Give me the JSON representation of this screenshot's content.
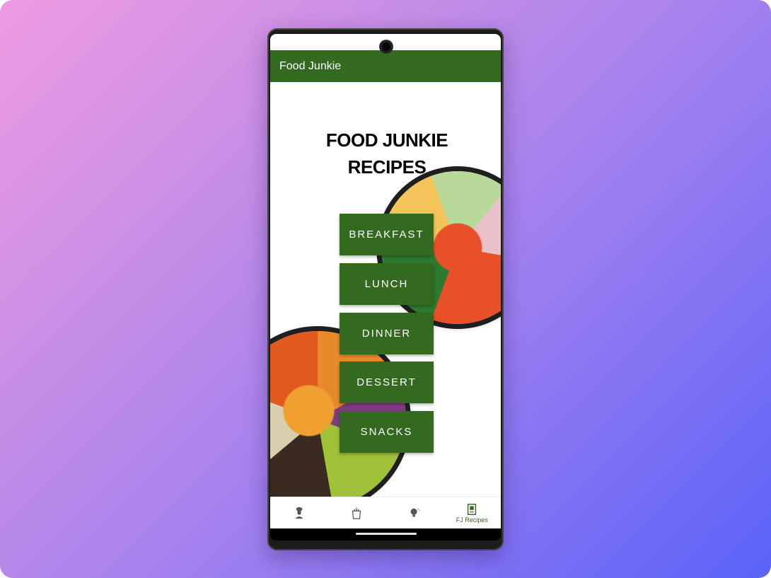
{
  "app": {
    "appbar_title": "Food Junkie",
    "heading_line1": "FOOD JUNKIE",
    "heading_line2": "RECIPES"
  },
  "menu": {
    "items": [
      {
        "label": "BREAKFAST"
      },
      {
        "label": "LUNCH"
      },
      {
        "label": "DINNER"
      },
      {
        "label": "DESSERT"
      },
      {
        "label": "SNACKS"
      }
    ]
  },
  "bottom_nav": {
    "items": [
      {
        "icon": "chef-icon",
        "label": ""
      },
      {
        "icon": "grocery-bag-icon",
        "label": ""
      },
      {
        "icon": "lightbulb-icon",
        "label": ""
      },
      {
        "icon": "recipe-book-icon",
        "label": "FJ Recipes",
        "active": true
      }
    ]
  },
  "colors": {
    "primary_green": "#346a20",
    "background_gradient_start": "#ef9be2",
    "background_gradient_end": "#5a62f8"
  }
}
